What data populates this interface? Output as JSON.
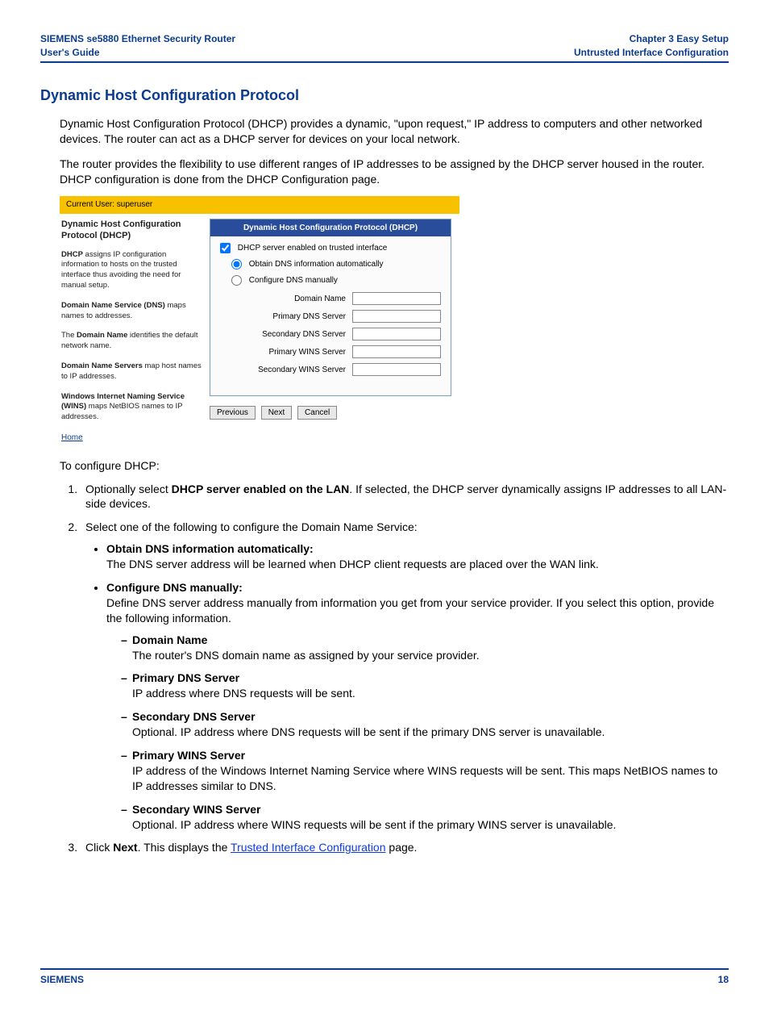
{
  "header": {
    "left_line1": "SIEMENS se5880 Ethernet Security Router",
    "left_line2": "User's Guide",
    "right_line1": "Chapter 3  Easy Setup",
    "right_line2": "Untrusted Interface Configuration"
  },
  "section_title": "Dynamic Host Configuration Protocol",
  "paras": {
    "p1": "Dynamic Host Configuration Protocol (DHCP) provides a dynamic, \"upon request,\" IP address to computers and other networked devices. The router can act as a DHCP server for devices on your local network.",
    "p2": "The router provides the flexibility to use different ranges of IP addresses to be assigned by the DHCP server housed in the router. DHCP configuration is done from the DHCP Configuration page."
  },
  "screenshot": {
    "current_user": "Current User: superuser",
    "side_title": "Dynamic Host Configuration Protocol (DHCP)",
    "side_p1_pre": "DHCP",
    "side_p1_rest": " assigns IP configuration information to hosts on the trusted interface thus avoiding the need for manual setup.",
    "side_p2_pre": "Domain Name Service (DNS)",
    "side_p2_rest": " maps names to addresses.",
    "side_p3_pre": "The ",
    "side_p3_bold": "Domain Name",
    "side_p3_rest": " identifies the default network name.",
    "side_p4_pre": "Domain Name Servers",
    "side_p4_rest": " map host names to IP addresses.",
    "side_p5_pre": "Windows Internet Naming Service (WINS)",
    "side_p5_rest": " maps NetBIOS names to IP addresses.",
    "home_link": "Home",
    "panel_title": "Dynamic Host Configuration Protocol (DHCP)",
    "cb_label": "DHCP server enabled on trusted interface",
    "rb1_label": "Obtain DNS information automatically",
    "rb2_label": "Configure DNS manually",
    "fields": {
      "domain": "Domain Name",
      "pdns": "Primary DNS Server",
      "sdns": "Secondary DNS Server",
      "pwins": "Primary WINS Server",
      "swins": "Secondary WINS Server"
    },
    "buttons": {
      "prev": "Previous",
      "next": "Next",
      "cancel": "Cancel"
    }
  },
  "instr": {
    "intro": "To configure DHCP:",
    "step1_pre": "Optionally select ",
    "step1_bold": "DHCP server enabled on the LAN",
    "step1_rest": ". If selected, the DHCP server dynamically assigns IP addresses to all LAN-side devices.",
    "step2": "Select one of the following to configure the Domain Name Service:",
    "b1_head": "Obtain DNS information automatically:",
    "b1_body": "The DNS server address will be learned when DHCP client requests are placed over the WAN link.",
    "b2_head": "Configure DNS manually:",
    "b2_body": "Define DNS server address manually from information you get from your service provider. If you select this option, provide the following information.",
    "d1_head": "Domain Name",
    "d1_body": "The router's DNS domain name as assigned by your service provider.",
    "d2_head": "Primary DNS Server",
    "d2_body": "IP address where DNS requests will be sent.",
    "d3_head": "Secondary DNS Server",
    "d3_body": "Optional. IP address where DNS requests will be sent if the primary DNS server is unavailable.",
    "d4_head": "Primary WINS Server",
    "d4_body": "IP address of the Windows Internet Naming Service where WINS requests will be sent. This maps NetBIOS names to IP addresses similar to DNS.",
    "d5_head": "Secondary WINS Server",
    "d5_body": "Optional. IP address where WINS requests will be sent if the primary WINS server is unavailable.",
    "step3_pre": "Click ",
    "step3_bold": "Next",
    "step3_mid": ". This displays the ",
    "step3_link": "Trusted Interface Configuration",
    "step3_end": " page."
  },
  "footer": {
    "left": "SIEMENS",
    "right": "18"
  }
}
